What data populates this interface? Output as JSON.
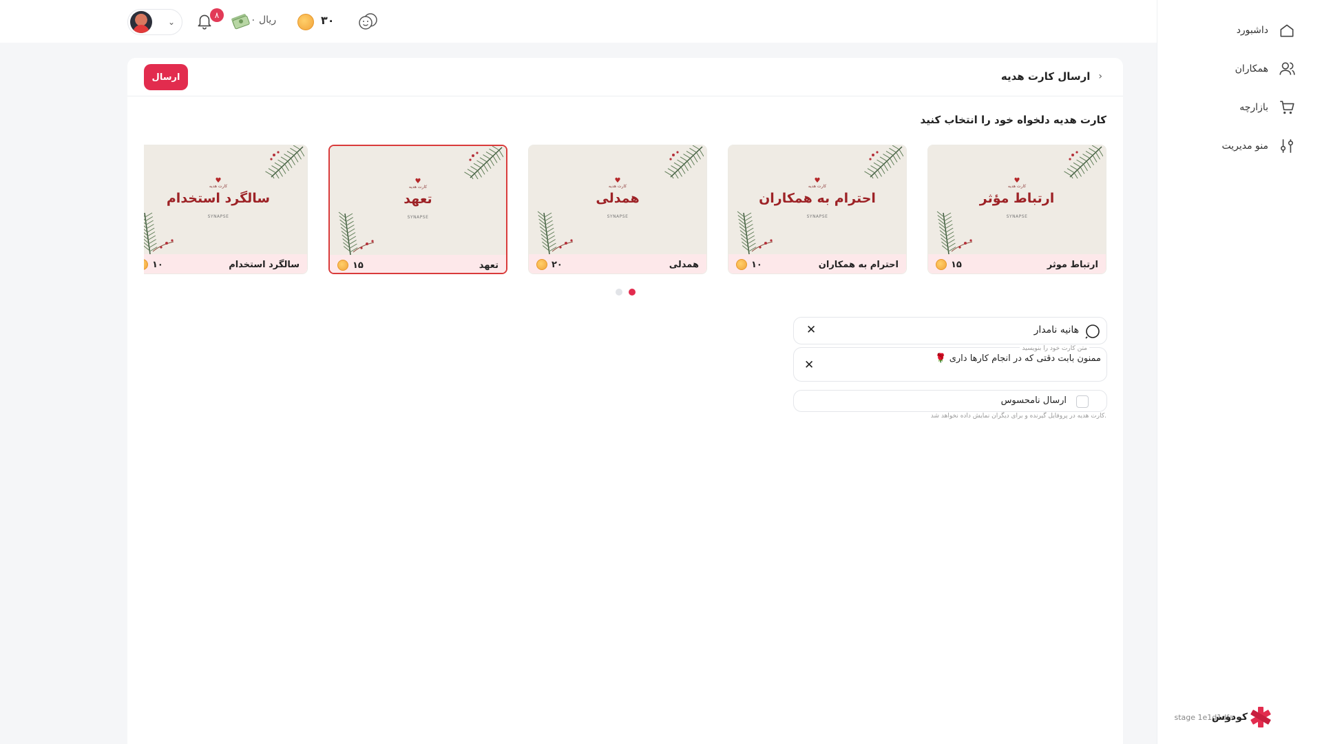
{
  "sidebar": {
    "items": [
      {
        "label": "داشبورد",
        "icon": "home-icon"
      },
      {
        "label": "همکاران",
        "icon": "users-icon"
      },
      {
        "label": "بازارچه",
        "icon": "cart-icon"
      },
      {
        "label": "منو مدیریت",
        "icon": "settings-sliders-icon"
      }
    ],
    "brand": {
      "name": "کودوس",
      "stage": "stage 1e1d1dfa"
    }
  },
  "topbar": {
    "notifications_count": "۸",
    "rial_balance": "۰ ریال",
    "coin_balance": "۳۰"
  },
  "page": {
    "title": "ارسال کارت هدیه",
    "send_label": "ارسال",
    "section_title": "کارت هدیه دلخواه خود را انتخاب کنید"
  },
  "cards": [
    {
      "title": "ارتباط مؤثر",
      "name": "ارتباط موثر",
      "cost": "۱۵",
      "small": "کارت هدیه",
      "brand": "SYNAPSE",
      "selected": false
    },
    {
      "title": "احترام به همکاران",
      "name": "احترام به همکاران",
      "cost": "۱۰",
      "small": "کارت هدیه",
      "brand": "SYNAPSE",
      "selected": false
    },
    {
      "title": "همدلی",
      "name": "همدلی",
      "cost": "۲۰",
      "small": "کارت هدیه",
      "brand": "SYNAPSE",
      "selected": false
    },
    {
      "title": "تعهد",
      "name": "تعهد",
      "cost": "۱۵",
      "small": "کارت هدیه",
      "brand": "SYNAPSE",
      "selected": true
    },
    {
      "title": "سالگرد استخدام",
      "name": "سالگرد استخدام",
      "cost": "۱۰",
      "small": "کارت هدیه",
      "brand": "SYNAPSE",
      "selected": false
    }
  ],
  "carousel": {
    "pages": 2,
    "active_page": 1
  },
  "form": {
    "recipient_value": "هانیه نامدار",
    "message_placeholder": "متن کارت خود را بنویسید",
    "message_value": "ممنون بابت دقتی که در انجام کارها داری 🌹",
    "anonymous_label": "ارسال نامحسوس",
    "anonymous_checked": false,
    "anonymous_help": "کارت هدیه در پروفایل گیرنده و برای دیگران نمایش داده نخواهد شد."
  },
  "colors": {
    "accent": "#e22c4e",
    "card_title": "#9d2226",
    "card_foot": "#fde8ea"
  }
}
